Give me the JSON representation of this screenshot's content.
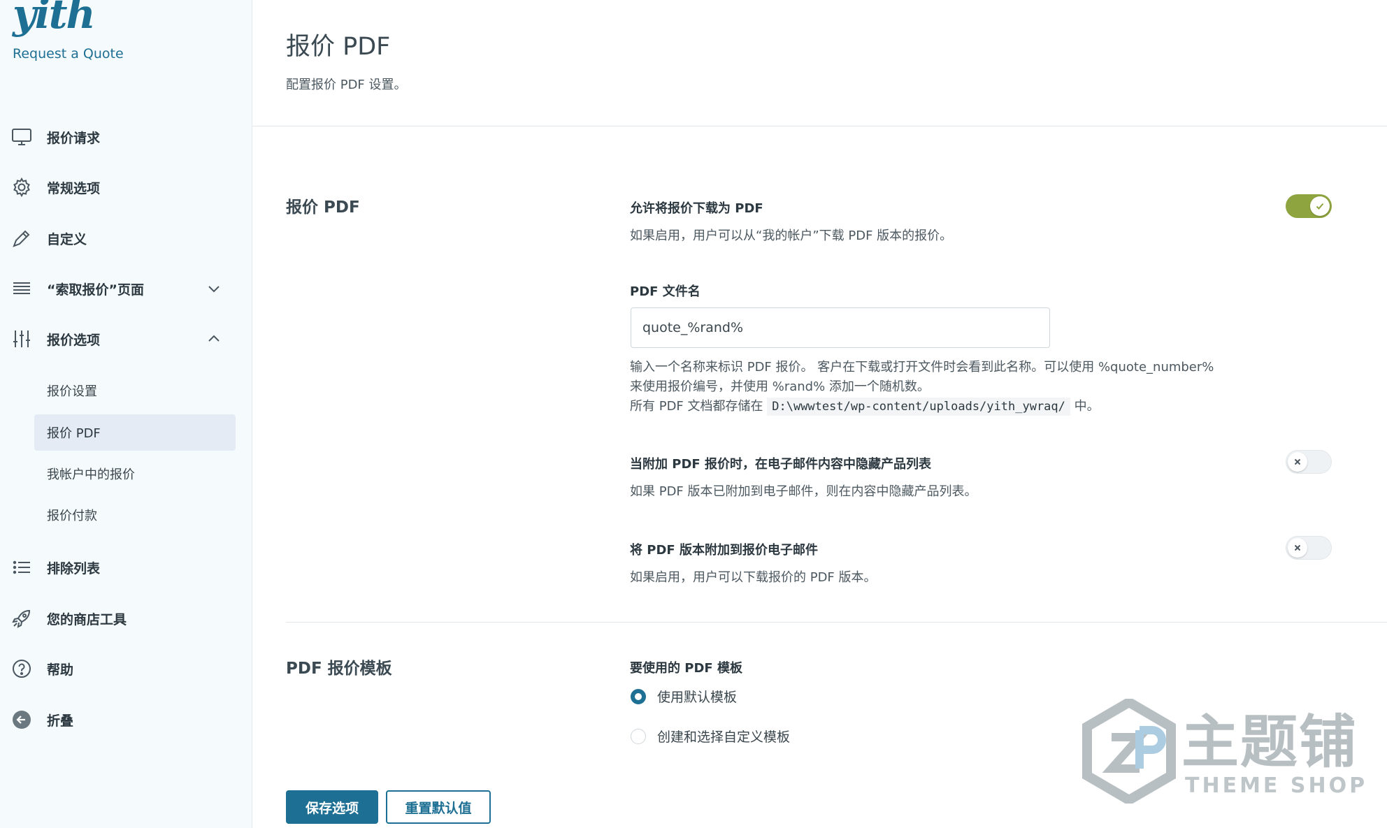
{
  "brand": {
    "logo": "yith",
    "product": "Request a Quote"
  },
  "sidebar": {
    "items": [
      {
        "label": "报价请求",
        "icon": "monitor-icon"
      },
      {
        "label": "常规选项",
        "icon": "gear-icon"
      },
      {
        "label": "自定义",
        "icon": "pen-icon"
      },
      {
        "label": "“索取报价”页面",
        "icon": "list-lines-icon",
        "expanded": false
      },
      {
        "label": "报价选项",
        "icon": "sliders-icon",
        "expanded": true
      },
      {
        "label": "排除列表",
        "icon": "bullet-list-icon"
      },
      {
        "label": "您的商店工具",
        "icon": "rocket-icon"
      },
      {
        "label": "帮助",
        "icon": "help-icon"
      },
      {
        "label": "折叠",
        "icon": "collapse-arrow-icon"
      }
    ],
    "subitems": [
      {
        "label": "报价设置",
        "active": false
      },
      {
        "label": "报价 PDF",
        "active": true
      },
      {
        "label": "我帐户中的报价",
        "active": false
      },
      {
        "label": "报价付款",
        "active": false
      }
    ]
  },
  "page": {
    "title": "报价 PDF",
    "description": "配置报价 PDF 设置。"
  },
  "sections": {
    "pdf": {
      "title": "报价 PDF",
      "allow_download": {
        "label": "允许将报价下载为 PDF",
        "description": "如果启用，用户可以从“我的帐户”下载 PDF 版本的报价。",
        "enabled": true
      },
      "filename": {
        "label": "PDF 文件名",
        "value": "quote_%rand%",
        "description_line1": "输入一个名称来标识 PDF 报价。 客户在下载或打开文件时会看到此名称。可以使用 %quote_number%",
        "description_line2": "来使用报价编号，并使用 %rand% 添加一个随机数。",
        "storage_prefix": "所有 PDF 文档都存储在",
        "storage_path": "D:\\wwwtest/wp-content/uploads/yith_ywraq/",
        "storage_suffix": "中。"
      },
      "hide_products": {
        "label": "当附加 PDF 报价时，在电子邮件内容中隐藏产品列表",
        "description": "如果 PDF 版本已附加到电子邮件，则在内容中隐藏产品列表。",
        "enabled": false
      },
      "attach_pdf": {
        "label": "将 PDF 版本附加到报价电子邮件",
        "description": "如果启用，用户可以下载报价的 PDF 版本。",
        "enabled": false
      }
    },
    "template": {
      "title": "PDF 报价模板",
      "field_label": "要使用的 PDF 模板",
      "options": [
        {
          "label": "使用默认模板",
          "checked": true
        },
        {
          "label": "创建和选择自定义模板",
          "checked": false
        }
      ]
    }
  },
  "buttons": {
    "save": "保存选项",
    "reset": "重置默认值"
  },
  "watermark": {
    "brand": "主题铺",
    "sub": "THEME SHOP"
  },
  "colors": {
    "accent": "#1d6f93",
    "toggle_on": "#8ea43e",
    "active_nav_bg": "#e4ebf5",
    "sidebar_bg": "#f5fafc"
  }
}
